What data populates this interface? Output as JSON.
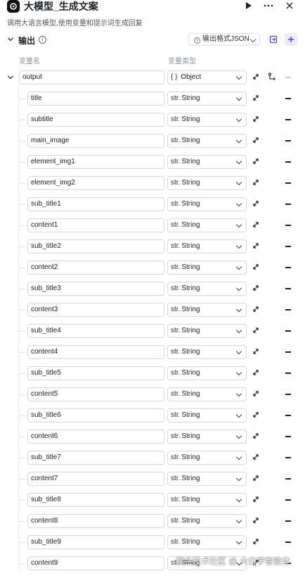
{
  "header": {
    "title": "大模型_生成文案",
    "description": "调用大语言模型,使用变量和提示词生成回复"
  },
  "output_section": {
    "label": "输出",
    "format_label": "输出格式JSON",
    "col_name": "变量名",
    "col_type": "变量类型"
  },
  "root": {
    "name": "output",
    "type_icon": "{ }",
    "type": "Object"
  },
  "fields": [
    {
      "name": "title",
      "type_icon": "str.",
      "type": "String"
    },
    {
      "name": "subtitle",
      "type_icon": "str.",
      "type": "String"
    },
    {
      "name": "main_image",
      "type_icon": "str.",
      "type": "String"
    },
    {
      "name": "element_img1",
      "type_icon": "str.",
      "type": "String"
    },
    {
      "name": "element_img2",
      "type_icon": "str.",
      "type": "String"
    },
    {
      "name": "sub_title1",
      "type_icon": "str.",
      "type": "String"
    },
    {
      "name": "content1",
      "type_icon": "str.",
      "type": "String"
    },
    {
      "name": "sub_title2",
      "type_icon": "str.",
      "type": "String"
    },
    {
      "name": "content2",
      "type_icon": "str.",
      "type": "String"
    },
    {
      "name": "sub_title3",
      "type_icon": "str.",
      "type": "String"
    },
    {
      "name": "content3",
      "type_icon": "str.",
      "type": "String"
    },
    {
      "name": "sub_title4",
      "type_icon": "str.",
      "type": "String"
    },
    {
      "name": "content4",
      "type_icon": "str.",
      "type": "String"
    },
    {
      "name": "sub_title5",
      "type_icon": "str.",
      "type": "String"
    },
    {
      "name": "content5",
      "type_icon": "str.",
      "type": "String"
    },
    {
      "name": "sub_title6",
      "type_icon": "str.",
      "type": "String"
    },
    {
      "name": "content6",
      "type_icon": "str.",
      "type": "String"
    },
    {
      "name": "sub_title7",
      "type_icon": "str.",
      "type": "String"
    },
    {
      "name": "content7",
      "type_icon": "str.",
      "type": "String"
    },
    {
      "name": "sub_title8",
      "type_icon": "str.",
      "type": "String"
    },
    {
      "name": "content8",
      "type_icon": "str.",
      "type": "String"
    },
    {
      "name": "sub_title9",
      "type_icon": "str.",
      "type": "String"
    },
    {
      "name": "content9",
      "type_icon": "str.",
      "type": "String"
    }
  ],
  "watermark": "掘金技术社区 @ 大白学智能体",
  "colors": {
    "accent": "#4e40e5",
    "accent_bg": "#eceafd"
  },
  "icons": [
    "logo-icon",
    "play-icon",
    "more-icon",
    "close-icon",
    "chevron-down-icon",
    "info-icon",
    "collapse-panel-icon",
    "add-icon",
    "expand-icon",
    "add-child-icon",
    "remove-icon"
  ]
}
